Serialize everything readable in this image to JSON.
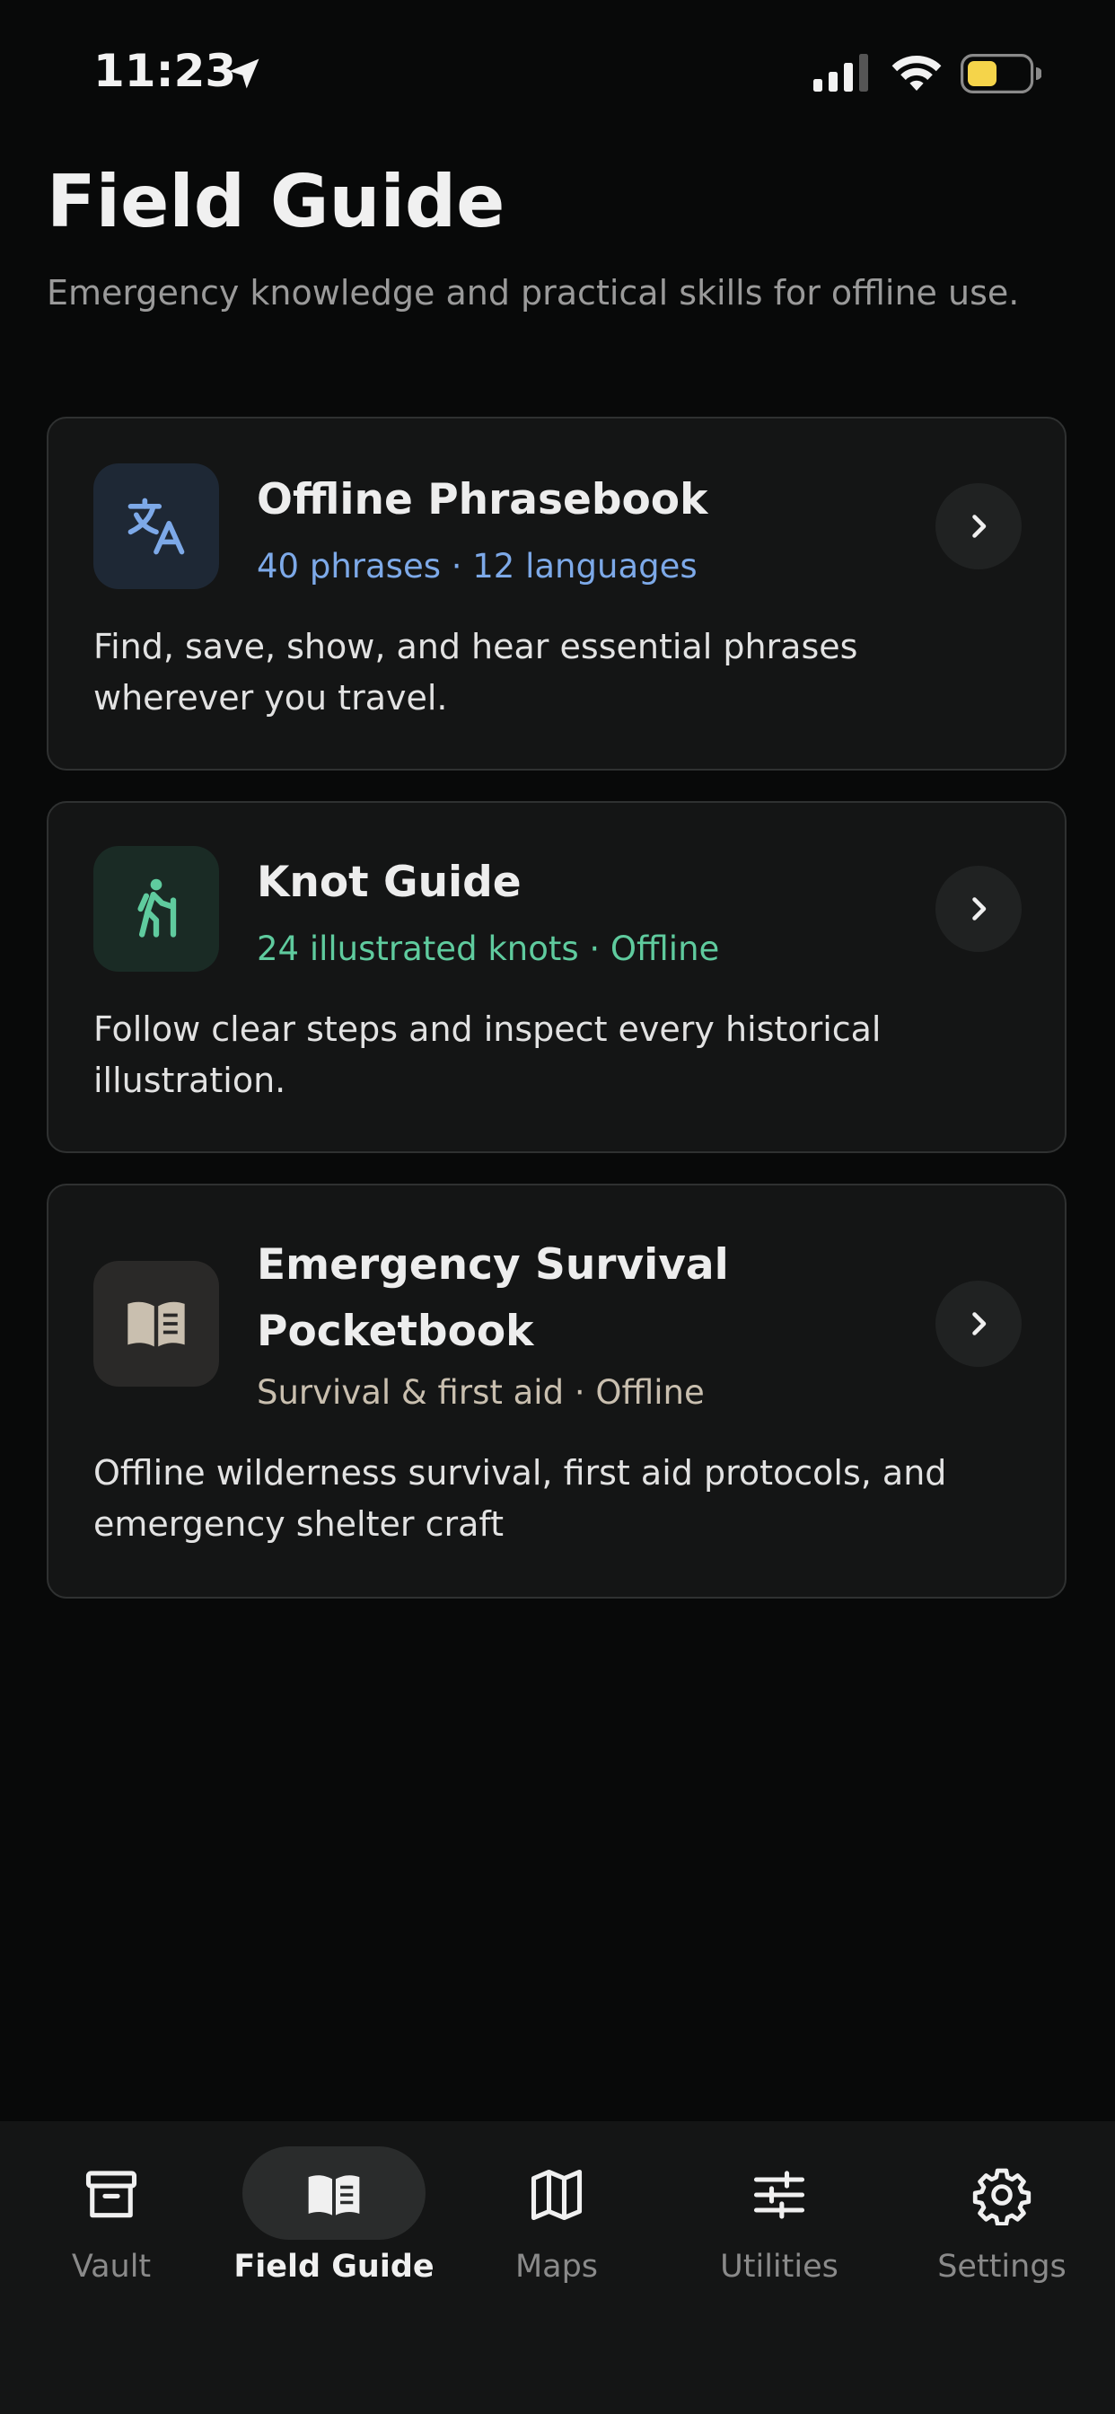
{
  "status_bar": {
    "time": "11:23"
  },
  "header": {
    "title": "Field Guide",
    "subtitle": "Emergency knowledge and practical skills for offline use."
  },
  "cards": [
    {
      "title": "Offline Phrasebook",
      "meta": "40 phrases · 12 languages",
      "description": "Find, save, show, and hear essential phrases wherever you travel.",
      "icon": "translate-icon",
      "accent": "#7DA9E8"
    },
    {
      "title": "Knot Guide",
      "meta": "24 illustrated knots · Offline",
      "description": "Follow clear steps and inspect every historical illustration.",
      "icon": "hiker-icon",
      "accent": "#5FCB9E"
    },
    {
      "title": "Emergency Survival Pocketbook",
      "meta": "Survival & first aid · Offline",
      "description": "Offline wilderness survival, first aid protocols, and emergency shelter craft",
      "icon": "book-icon",
      "accent": "#C9BFAF"
    }
  ],
  "tab_bar": {
    "tabs": [
      {
        "label": "Vault",
        "icon": "archive-box-icon",
        "active": false
      },
      {
        "label": "Field Guide",
        "icon": "open-book-icon",
        "active": true
      },
      {
        "label": "Maps",
        "icon": "map-icon",
        "active": false
      },
      {
        "label": "Utilities",
        "icon": "sliders-icon",
        "active": false
      },
      {
        "label": "Settings",
        "icon": "gear-icon",
        "active": false
      }
    ]
  },
  "colors": {
    "background": "#080909",
    "card_background": "#141515",
    "battery_fill": "#F5D44A"
  }
}
